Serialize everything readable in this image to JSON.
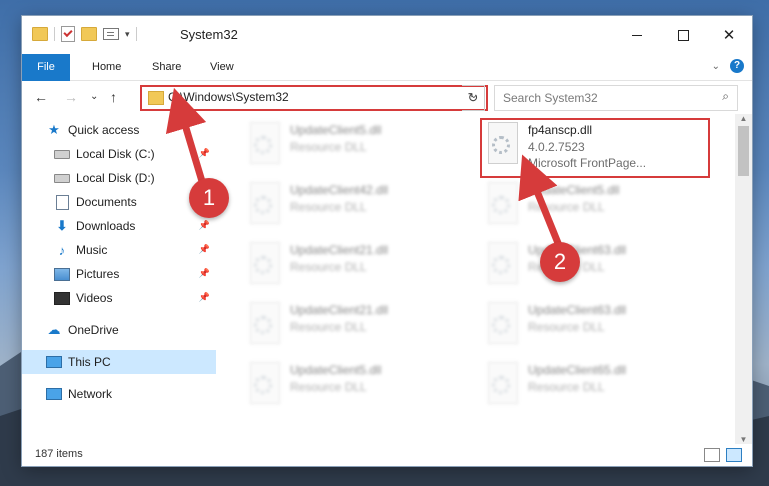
{
  "window": {
    "title": "System32",
    "minimize": "",
    "maximize": "",
    "close": "✕"
  },
  "ribbon": {
    "tabs": [
      "File",
      "Home",
      "Share",
      "View"
    ],
    "expand_icon": "⌄",
    "help": "?"
  },
  "address": {
    "path": "C:\\Windows\\System32",
    "dropdown": "⌄",
    "refresh": "↻",
    "search_placeholder": "Search System32",
    "search_icon": "⌕",
    "back": "←",
    "forward": "→",
    "recent": "⌄",
    "up": "↑"
  },
  "sidebar": {
    "items": [
      {
        "label": "Quick access",
        "icon": "star-icon",
        "pinned": false
      },
      {
        "label": "Local Disk (C:)",
        "icon": "drive-icon",
        "pinned": true
      },
      {
        "label": "Local Disk (D:)",
        "icon": "drive-icon",
        "pinned": false
      },
      {
        "label": "Documents",
        "icon": "document-icon",
        "pinned": true
      },
      {
        "label": "Downloads",
        "icon": "download-icon",
        "pinned": true
      },
      {
        "label": "Music",
        "icon": "music-icon",
        "pinned": true
      },
      {
        "label": "Pictures",
        "icon": "pictures-icon",
        "pinned": true
      },
      {
        "label": "Videos",
        "icon": "videos-icon",
        "pinned": true
      },
      {
        "label": "OneDrive",
        "icon": "cloud-icon",
        "pinned": false
      },
      {
        "label": "This PC",
        "icon": "computer-icon",
        "pinned": false,
        "selected": true
      },
      {
        "label": "Network",
        "icon": "network-icon",
        "pinned": false
      }
    ]
  },
  "files": {
    "left": [
      {
        "name": "UpdateClient5.dll",
        "type": "Resource DLL"
      },
      {
        "name": "UpdateClient42.dll",
        "type": "Resource DLL"
      },
      {
        "name": "UpdateClient21.dll",
        "type": "Resource DLL"
      },
      {
        "name": "UpdateClient21.dll",
        "type": "Resource DLL"
      },
      {
        "name": "UpdateClient5.dll",
        "type": "Resource DLL"
      }
    ],
    "right": [
      {
        "name": "fp4anscp.dll",
        "type": "4.0.2.7523",
        "extra": "Microsoft FrontPage..."
      },
      {
        "name": "UpdateClient5.dll",
        "type": "Resource DLL"
      },
      {
        "name": "UpdateClient63.dll",
        "type": "Resource DLL"
      },
      {
        "name": "UpdateClient63.dll",
        "type": "Resource DLL"
      },
      {
        "name": "UpdateClient65.dll",
        "type": "Resource DLL"
      }
    ]
  },
  "status": {
    "count": "187 items"
  },
  "annotations": {
    "badge1": "1",
    "badge2": "2",
    "color": "#d63b3b"
  }
}
